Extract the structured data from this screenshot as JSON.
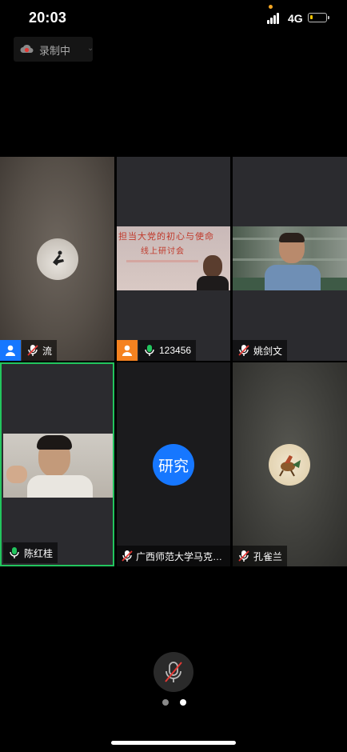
{
  "status": {
    "time": "20:03",
    "network": "4G",
    "battery_level": 0.2
  },
  "recording": {
    "label": "录制中",
    "icon": "cloud-icon"
  },
  "participants": [
    {
      "name": "流",
      "mic": "muted",
      "badge": "user-icon",
      "badge_color": "#1677ff",
      "video": "avatar"
    },
    {
      "name": "123456",
      "mic": "active",
      "badge": "user-icon",
      "badge_color": "#f58220",
      "video": "camera"
    },
    {
      "name": "姚剑文",
      "mic": "muted",
      "video": "camera"
    },
    {
      "name": "陈红桂",
      "mic": "active",
      "video": "camera",
      "active_speaker": true
    },
    {
      "name": "广西师范大学马克思主...",
      "mic": "muted",
      "video": "text-avatar",
      "avatar_text": "研究",
      "avatar_color": "#1677ff"
    },
    {
      "name": "孔雀兰",
      "mic": "muted",
      "video": "avatar"
    }
  ],
  "slide": {
    "line1": "担当大党的初心与使命",
    "line2": "线上研讨会"
  },
  "controls": {
    "mute_icon": "mic-muted-icon",
    "page_count": 2,
    "active_page": 1
  },
  "colors": {
    "active_speaker_border": "#22c55e",
    "mic_active": "#22c55e",
    "mic_muted_slash": "#e53935"
  }
}
